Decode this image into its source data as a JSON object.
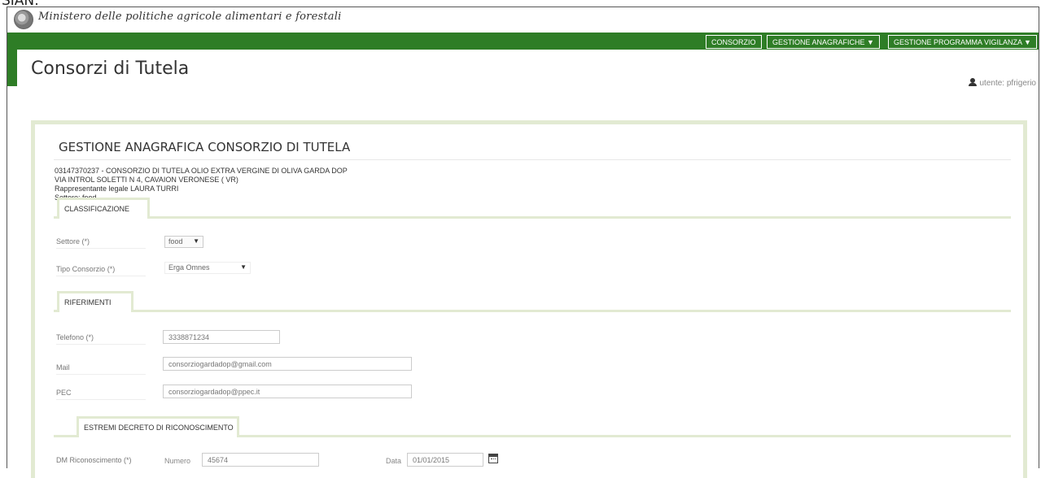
{
  "caption": "SIAN:",
  "header": {
    "ministry": "Ministero delle politiche agricole alimentari e forestali",
    "nav": [
      {
        "label": "CONSORZIO"
      },
      {
        "label": "GESTIONE ANAGRAFICHE ▼"
      },
      {
        "label": "GESTIONE PROGRAMMA VIGILANZA ▼"
      }
    ],
    "page_title": "Consorzi di Tutela",
    "user_label": "utente: pfrigerio"
  },
  "panel": {
    "title": "GESTIONE ANAGRAFICA CONSORZIO DI TUTELA",
    "info": [
      "03147370237 - CONSORZIO DI TUTELA OLIO EXTRA VERGINE DI OLIVA GARDA DOP",
      "VIA INTROL SOLETTI N 4, CAVAION VERONESE ( VR)",
      "Rappresentante legale LAURA TURRI",
      "Settore: food"
    ]
  },
  "classificazione": {
    "tab": "CLASSIFICAZIONE",
    "settore_label": "Settore (*)",
    "settore_value": "food",
    "tipo_label": "Tipo Consorzio (*)",
    "tipo_value": "Erga Omnes"
  },
  "riferimenti": {
    "tab": "RIFERIMENTI",
    "telefono_label": "Telefono (*)",
    "telefono_value": "3338871234",
    "mail_label": "Mail",
    "mail_value": "consorziogardadop@gmail.com",
    "pec_label": "PEC",
    "pec_value": "consorziogardadop@ppec.it"
  },
  "estremi": {
    "tab": "ESTREMI DECRETO DI RICONOSCIMENTO",
    "dm_label": "DM Riconoscimento (*)",
    "numero_label": "Numero",
    "numero_value": "45674",
    "data_label": "Data",
    "data_value": "01/01/2015"
  },
  "icons": {
    "user": "user-icon",
    "calendar": "calendar-icon",
    "emblem": "republic-emblem-icon"
  },
  "colors": {
    "brand_green": "#2e7d26",
    "panel_border": "#e2ead2"
  }
}
